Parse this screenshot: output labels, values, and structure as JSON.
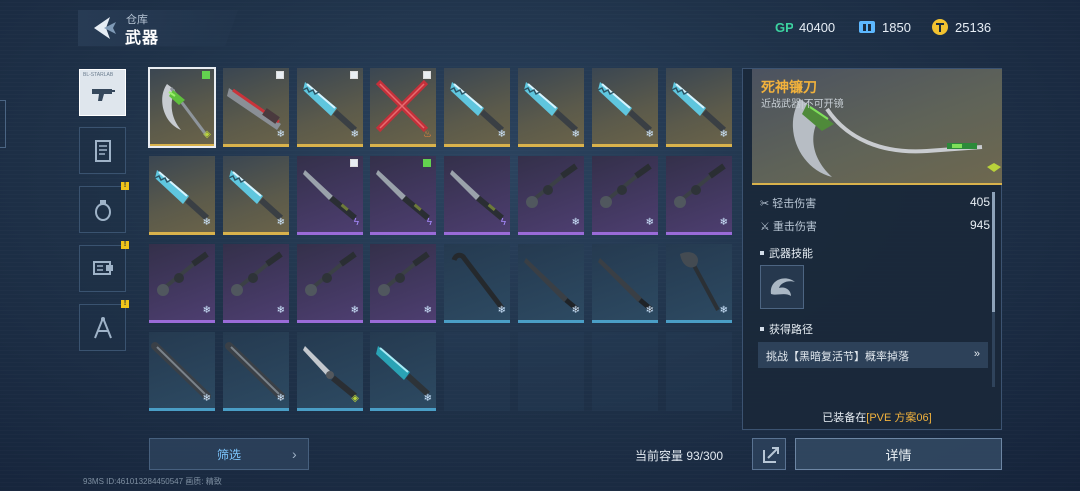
{
  "header": {
    "breadcrumb": "仓库",
    "title": "武器"
  },
  "currency": [
    {
      "icon": "gp-icon",
      "value": "40400",
      "color": "#3cd2a0"
    },
    {
      "icon": "ticket-icon",
      "value": "1850",
      "color": "#5db8ff"
    },
    {
      "icon": "coin-icon",
      "value": "25136",
      "color": "#f2c230"
    }
  ],
  "left_tabs": [
    {
      "icon": "gun-icon",
      "selected": true,
      "badge": false,
      "tag": "BL-STARLAB"
    },
    {
      "icon": "scroll-icon",
      "selected": false,
      "badge": false
    },
    {
      "icon": "grenade-icon",
      "selected": false,
      "badge": true
    },
    {
      "icon": "gear-icon",
      "selected": false,
      "badge": true
    },
    {
      "icon": "compass-icon",
      "selected": false,
      "badge": true
    }
  ],
  "grid": [
    [
      {
        "rarity": "gold",
        "weapon": "scythe-green",
        "check": "green",
        "elem": "ghost",
        "selected": true
      },
      {
        "rarity": "gold",
        "weapon": "blade-red",
        "check": "white",
        "elem": "frost"
      },
      {
        "rarity": "gold",
        "weapon": "knife-blue",
        "check": "white",
        "elem": "frost"
      },
      {
        "rarity": "gold",
        "weapon": "crossed-red",
        "check": "white",
        "elem": "fire"
      },
      {
        "rarity": "gold",
        "weapon": "knife-blue",
        "elem": "frost"
      },
      {
        "rarity": "gold",
        "weapon": "knife-blue",
        "elem": "frost"
      },
      {
        "rarity": "gold",
        "weapon": "knife-blue",
        "elem": "frost"
      },
      {
        "rarity": "gold",
        "weapon": "knife-blue",
        "elem": "frost"
      }
    ],
    [
      {
        "rarity": "gold",
        "weapon": "knife-blue",
        "elem": "frost"
      },
      {
        "rarity": "gold",
        "weapon": "knife-blue",
        "elem": "frost"
      },
      {
        "rarity": "purple",
        "weapon": "dagger",
        "check": "white",
        "elem": "bolt"
      },
      {
        "rarity": "purple",
        "weapon": "dagger",
        "check": "green",
        "elem": "bolt"
      },
      {
        "rarity": "purple",
        "weapon": "dagger",
        "elem": "bolt"
      },
      {
        "rarity": "purple",
        "weapon": "flail",
        "elem": "frost"
      },
      {
        "rarity": "purple",
        "weapon": "flail",
        "elem": "frost"
      },
      {
        "rarity": "purple",
        "weapon": "flail",
        "elem": "frost"
      }
    ],
    [
      {
        "rarity": "purple",
        "weapon": "flail",
        "elem": "frost"
      },
      {
        "rarity": "purple",
        "weapon": "flail",
        "elem": "frost"
      },
      {
        "rarity": "purple",
        "weapon": "flail",
        "elem": "frost"
      },
      {
        "rarity": "purple",
        "weapon": "flail",
        "elem": "frost"
      },
      {
        "rarity": "blue",
        "weapon": "crowbar",
        "elem": "frost"
      },
      {
        "rarity": "blue",
        "weapon": "machete",
        "elem": "frost"
      },
      {
        "rarity": "blue",
        "weapon": "machete",
        "elem": "frost"
      },
      {
        "rarity": "blue",
        "weapon": "axe",
        "elem": "frost"
      }
    ],
    [
      {
        "rarity": "blue",
        "weapon": "bat",
        "elem": "frost"
      },
      {
        "rarity": "blue",
        "weapon": "bat",
        "elem": "frost"
      },
      {
        "rarity": "blue",
        "weapon": "dagger2",
        "elem": "ghost"
      },
      {
        "rarity": "blue",
        "weapon": "knife-teal",
        "elem": "frost"
      },
      {
        "rarity": "empty"
      },
      {
        "rarity": "empty"
      },
      {
        "rarity": "empty"
      },
      {
        "rarity": "empty"
      }
    ]
  ],
  "detail": {
    "name": "死神镰刀",
    "type": "近战武器|不可开镜",
    "stats": [
      {
        "label": "轻击伤害",
        "value": "405"
      },
      {
        "label": "重击伤害",
        "value": "945"
      }
    ],
    "skill_title": "武器技能",
    "source_title": "获得路径",
    "source": "挑战【黑暗复活节】概率掉落",
    "equipped_prefix": "已装备在",
    "equipped_plan": "[PVE 方案06]"
  },
  "bottom": {
    "filter_label": "筛选",
    "capacity": "当前容量 93/300",
    "detail_button": "详情"
  },
  "footer": "93MS  ID:461013284450547  画质: 精致"
}
